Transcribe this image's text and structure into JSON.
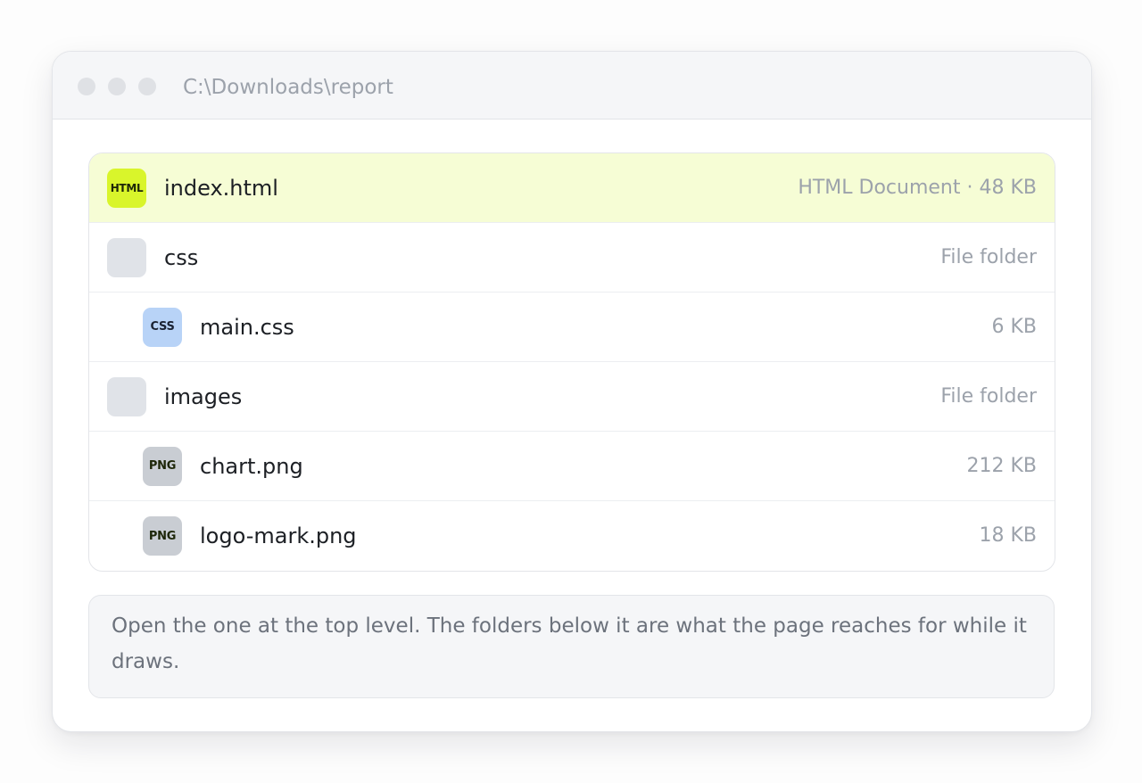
{
  "window": {
    "path": "C:\\Downloads\\report"
  },
  "files": [
    {
      "name": "index.html",
      "meta": "HTML Document · 48 KB",
      "icon": "HTML",
      "icon_type": "html-file-icon",
      "selected": true
    },
    {
      "name": "css",
      "meta": "File folder",
      "icon": "",
      "icon_type": "folder-icon"
    },
    {
      "name": "main.css",
      "meta": "6 KB",
      "icon": "CSS",
      "icon_type": "css-file-icon"
    },
    {
      "name": "images",
      "meta": "File folder",
      "icon": "",
      "icon_type": "folder-icon"
    },
    {
      "name": "chart.png",
      "meta": "212 KB",
      "icon": "PNG",
      "icon_type": "png-file-icon"
    },
    {
      "name": "logo-mark.png",
      "meta": "18 KB",
      "icon": "PNG",
      "icon_type": "png-file-icon"
    }
  ],
  "note": "Open the one at the top level. The folders below it are what the page reaches for while it draws.",
  "colors": {
    "selected_row": "#f6fdd5",
    "html_icon": "#d9f52b",
    "css_icon": "#b8d3f7",
    "png_icon": "#c9cdd3",
    "folder_icon": "#e0e3e8"
  }
}
